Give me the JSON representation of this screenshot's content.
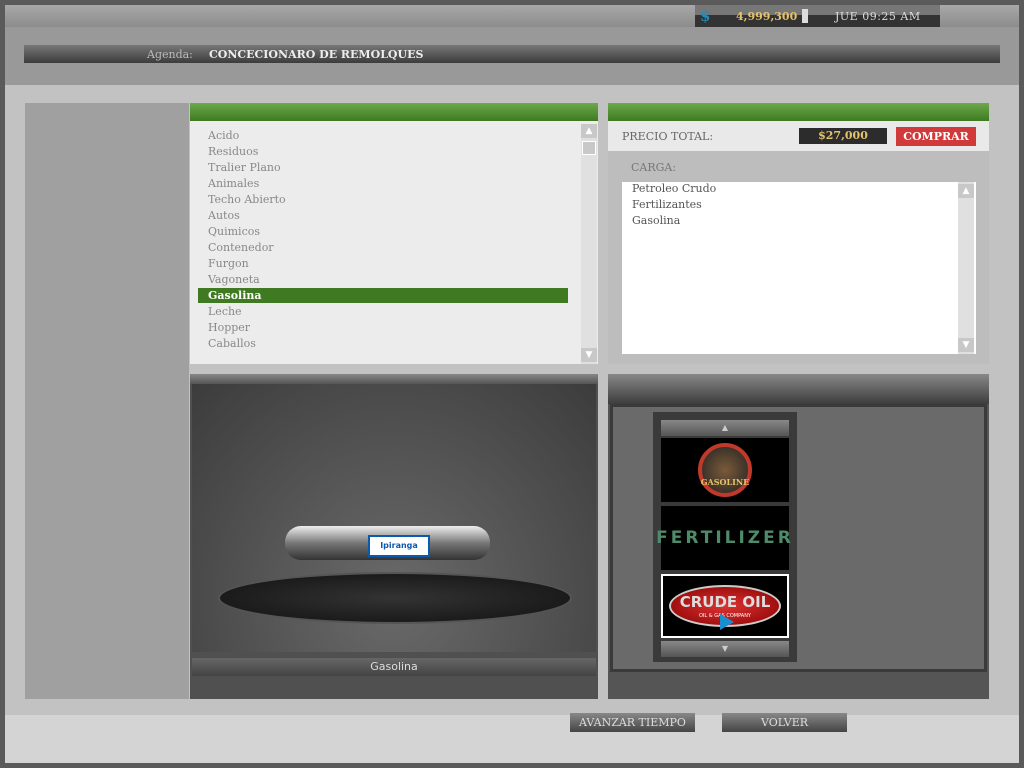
{
  "status": {
    "money_icon": "dollar-icon",
    "money": "4,999,300",
    "clock": "JUE 09:25 AM"
  },
  "agenda": {
    "label": "Agenda:",
    "value": "CONCECIONARO DE REMOLQUES"
  },
  "trailer_types": {
    "items": [
      "Acido",
      "Residuos",
      "Tralier Plano",
      "Animales",
      "Techo Abierto",
      "Autos",
      "Quimicos",
      "Contenedor",
      "Furgon",
      "Vagoneta",
      "Gasolina",
      "Leche",
      "Hopper",
      "Caballos"
    ],
    "selected": "Gasolina"
  },
  "purchase": {
    "price_label": "PRECIO TOTAL:",
    "price": "$27,000",
    "buy_label": "COMPRAR",
    "cargo_label": "CARGA:",
    "cargo": [
      "Petroleo Crudo",
      "Fertilizantes",
      "Gasolina"
    ]
  },
  "preview": {
    "name": "Gasolina",
    "tanker_logo": "Ipiranga"
  },
  "logos": {
    "items": [
      "GASOLINE",
      "FERTILIZER",
      "CRUDE OIL"
    ],
    "crude_sub": "OIL & GAS COMPANY",
    "selected": "CRUDE OIL"
  },
  "footer": {
    "advance_label": "AVANZAR TIEMPO",
    "back_label": "VOLVER"
  },
  "colors": {
    "accent_green": "#3f7a22",
    "buy_red": "#d13a3a",
    "money_gold": "#e5c36a"
  }
}
